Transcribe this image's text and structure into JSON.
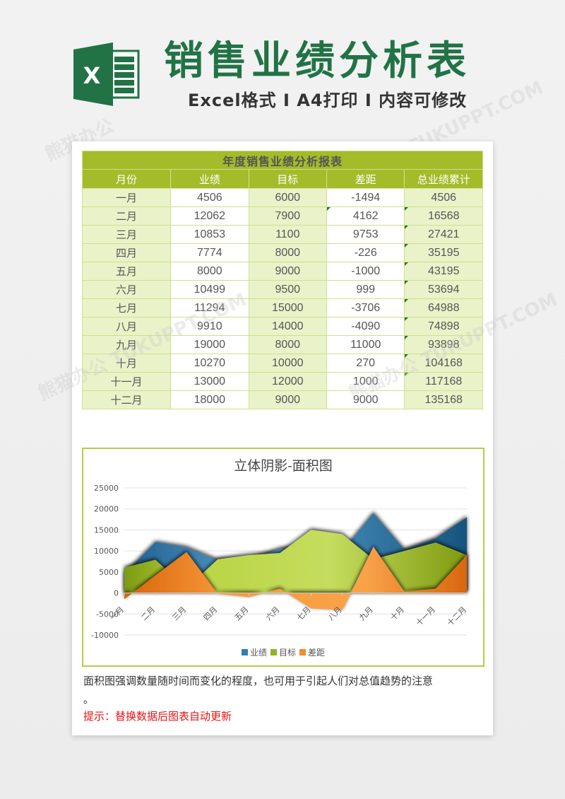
{
  "header": {
    "logo_letter": "X",
    "title": "销售业绩分析表",
    "subtitle": "Excel格式 I A4打印 I 内容可修改"
  },
  "table": {
    "title": "年度销售业绩分析报表",
    "columns": [
      "月份",
      "业绩",
      "目标",
      "差距",
      "总业绩累计"
    ],
    "rows": [
      [
        "一月",
        "4506",
        "6000",
        "-1494",
        "4506"
      ],
      [
        "二月",
        "12062",
        "7900",
        "4162",
        "16568"
      ],
      [
        "三月",
        "10853",
        "1100",
        "9753",
        "27421"
      ],
      [
        "四月",
        "7774",
        "8000",
        "-226",
        "35195"
      ],
      [
        "五月",
        "8000",
        "9000",
        "-1000",
        "43195"
      ],
      [
        "六月",
        "10499",
        "9500",
        "999",
        "53694"
      ],
      [
        "七月",
        "11294",
        "15000",
        "-3706",
        "64988"
      ],
      [
        "八月",
        "9910",
        "14000",
        "-4090",
        "74898"
      ],
      [
        "九月",
        "19000",
        "8000",
        "11000",
        "93898"
      ],
      [
        "十月",
        "10270",
        "10000",
        "270",
        "104168"
      ],
      [
        "十一月",
        "13000",
        "12000",
        "1000",
        "117168"
      ],
      [
        "十二月",
        "18000",
        "9000",
        "9000",
        "135168"
      ]
    ]
  },
  "chart_data": {
    "type": "area",
    "title": "立体阴影-面积图",
    "categories": [
      "一月",
      "二月",
      "三月",
      "四月",
      "五月",
      "六月",
      "七月",
      "八月",
      "九月",
      "十月",
      "十一月",
      "十二月"
    ],
    "series": [
      {
        "name": "业绩",
        "color": "#2e7fb8",
        "values": [
          4506,
          12062,
          10853,
          7774,
          8000,
          10499,
          11294,
          9910,
          19000,
          10270,
          13000,
          18000
        ]
      },
      {
        "name": "目标",
        "color": "#a4c639",
        "values": [
          6000,
          7900,
          1100,
          8000,
          9000,
          9500,
          15000,
          14000,
          8000,
          10000,
          12000,
          9000
        ]
      },
      {
        "name": "差距",
        "color": "#f28e2b",
        "values": [
          -1494,
          4162,
          9753,
          -226,
          -1000,
          999,
          -3706,
          -4090,
          11000,
          270,
          1000,
          9000
        ]
      }
    ],
    "ylim": [
      -10000,
      25000
    ],
    "yticks": [
      "25000",
      "20000",
      "15000",
      "10000",
      "5000",
      "0",
      "-5000",
      "-10000"
    ],
    "ytick_values": [
      25000,
      20000,
      15000,
      10000,
      5000,
      0,
      -5000,
      -10000
    ],
    "grid": true,
    "legend": "bottom",
    "xlabel": "",
    "ylabel": ""
  },
  "notes": {
    "description": "面积图强调数量随时间而变化的程度，也可用于引起人们对总值趋势的注意",
    "description_end": "。",
    "tip": "提示：替换数据后图表自动更新"
  }
}
